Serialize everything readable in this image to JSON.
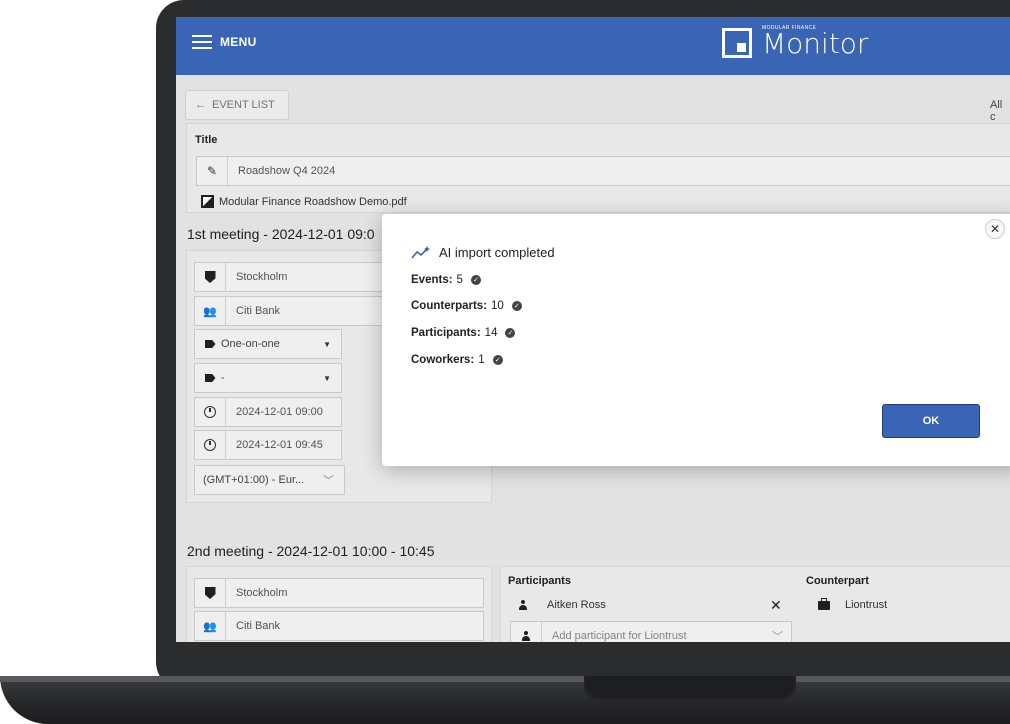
{
  "header": {
    "menu_label": "MENU",
    "logo_small": "MODULAR FINANCE",
    "logo_text": "Monitor",
    "brand_color": "#3a64b4"
  },
  "nav": {
    "event_list_label": "EVENT LIST",
    "all_label": "All c"
  },
  "title_section": {
    "label": "Title",
    "title_value": "Roadshow Q4 2024",
    "attachment": "Modular Finance Roadshow Demo.pdf"
  },
  "meeting1": {
    "heading": "1st meeting - 2024-12-01 09:0",
    "location": "Stockholm",
    "company": "Citi Bank",
    "meeting_type": "One-on-one",
    "tag": "-",
    "start": "2024-12-01 09:00",
    "end": "2024-12-01 09:45",
    "timezone": "(GMT+01:00) - Eur..."
  },
  "meeting2": {
    "heading": "2nd meeting - 2024-12-01 10:00 - 10:45",
    "location": "Stockholm",
    "company": "Citi Bank",
    "participants_label": "Participants",
    "participant": "Aitken Ross",
    "add_participant_placeholder": "Add participant for Liontrust",
    "counterpart_label": "Counterpart",
    "counterpart": "Liontrust"
  },
  "dialog": {
    "title": "AI import completed",
    "rows": [
      {
        "label": "Events:",
        "value": "5"
      },
      {
        "label": "Counterparts:",
        "value": "10"
      },
      {
        "label": "Participants:",
        "value": "14"
      },
      {
        "label": "Coworkers:",
        "value": "1"
      }
    ],
    "ok_label": "OK",
    "close_symbol": "✕"
  }
}
